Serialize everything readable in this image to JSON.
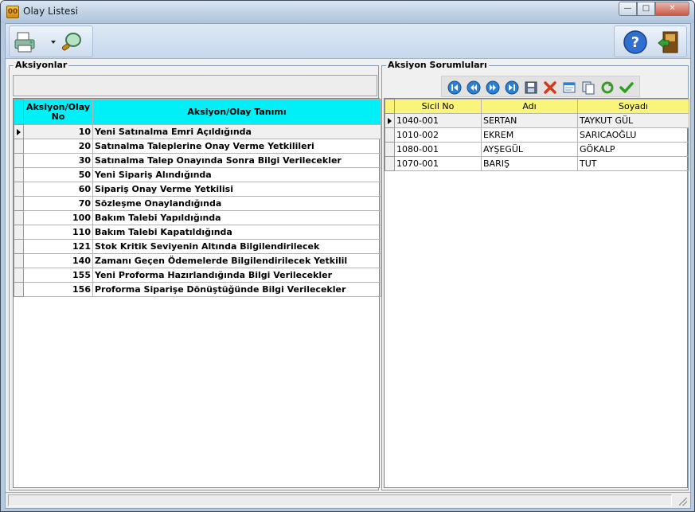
{
  "window": {
    "title": "Olay Listesi",
    "app_icon_text": "00",
    "controls": {
      "minimize": "—",
      "maximize": "□",
      "close": "✕"
    }
  },
  "toolbar": {
    "left_icons": [
      "print-icon",
      "search-icon"
    ],
    "right_icons": [
      "help-icon",
      "exit-icon"
    ]
  },
  "left_panel": {
    "title": "Aksiyonlar",
    "grid": {
      "columns": [
        "Aksiyon/Olay No",
        "Aksiyon/Olay Tanımı"
      ],
      "rows": [
        {
          "no": "10",
          "desc": "Yeni Satınalma Emri Açıldığında"
        },
        {
          "no": "20",
          "desc": "Satınalma Taleplerine Onay Verme Yetkilileri"
        },
        {
          "no": "30",
          "desc": "Satınalma Talep Onayında Sonra Bilgi Verilecekler"
        },
        {
          "no": "50",
          "desc": "Yeni Sipariş Alındığında"
        },
        {
          "no": "60",
          "desc": "Sipariş Onay Verme Yetkilisi"
        },
        {
          "no": "70",
          "desc": "Sözleşme Onaylandığında"
        },
        {
          "no": "100",
          "desc": "Bakım Talebi Yapıldığında"
        },
        {
          "no": "110",
          "desc": "Bakım Talebi Kapatıldığında"
        },
        {
          "no": "121",
          "desc": "Stok Kritik Seviyenin Altında Bilgilendirilecek"
        },
        {
          "no": "140",
          "desc": "Zamanı Geçen Ödemelerde Bilgilendirilecek Yetkilil"
        },
        {
          "no": "155",
          "desc": "Yeni Proforma Hazırlandığında Bilgi Verilecekler"
        },
        {
          "no": "156",
          "desc": "Proforma Siparişe Dönüştüğünde Bilgi Verilecekler"
        }
      ]
    }
  },
  "right_panel": {
    "title": "Aksiyon Sorumluları",
    "navigator": [
      "first-icon",
      "prior-icon",
      "next-icon",
      "last-icon",
      "save-icon",
      "delete-icon",
      "edit-icon",
      "copy-icon",
      "refresh-icon",
      "check-icon"
    ],
    "grid": {
      "columns": [
        "Sicil No",
        "Adı",
        "Soyadı"
      ],
      "rows": [
        {
          "sicil": "1040-001",
          "adi": "SERTAN",
          "soyadi": "TAYKUT GÜL"
        },
        {
          "sicil": "1010-002",
          "adi": "EKREM",
          "soyadi": "SARICAOĞLU"
        },
        {
          "sicil": "1080-001",
          "adi": "AYŞEGÜL",
          "soyadi": "GÖKALP"
        },
        {
          "sicil": "1070-001",
          "adi": "BARIŞ",
          "soyadi": "TUT"
        }
      ]
    }
  },
  "colors": {
    "left_header": "#00f0f8",
    "right_header": "#fbf47a",
    "frame": "#b6c9de"
  }
}
